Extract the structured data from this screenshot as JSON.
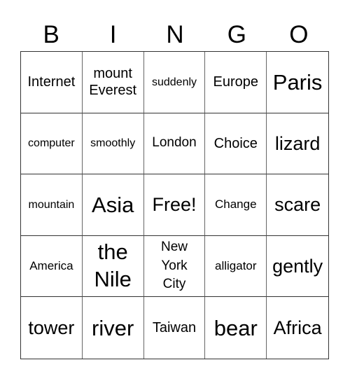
{
  "header": {
    "letters": [
      "B",
      "I",
      "N",
      "G",
      "O"
    ]
  },
  "grid": {
    "rows": [
      [
        "Internet",
        "mount Everest",
        "suddenly",
        "Europe",
        "Paris"
      ],
      [
        "computer",
        "smoothly",
        "London",
        "Choice",
        "lizard"
      ],
      [
        "mountain",
        "Asia",
        "Free!",
        "Change",
        "scare"
      ],
      [
        "America",
        "the Nile",
        "New York City",
        "alligator",
        "gently"
      ],
      [
        "tower",
        "river",
        "Taiwan",
        "bear",
        "Africa"
      ]
    ]
  }
}
